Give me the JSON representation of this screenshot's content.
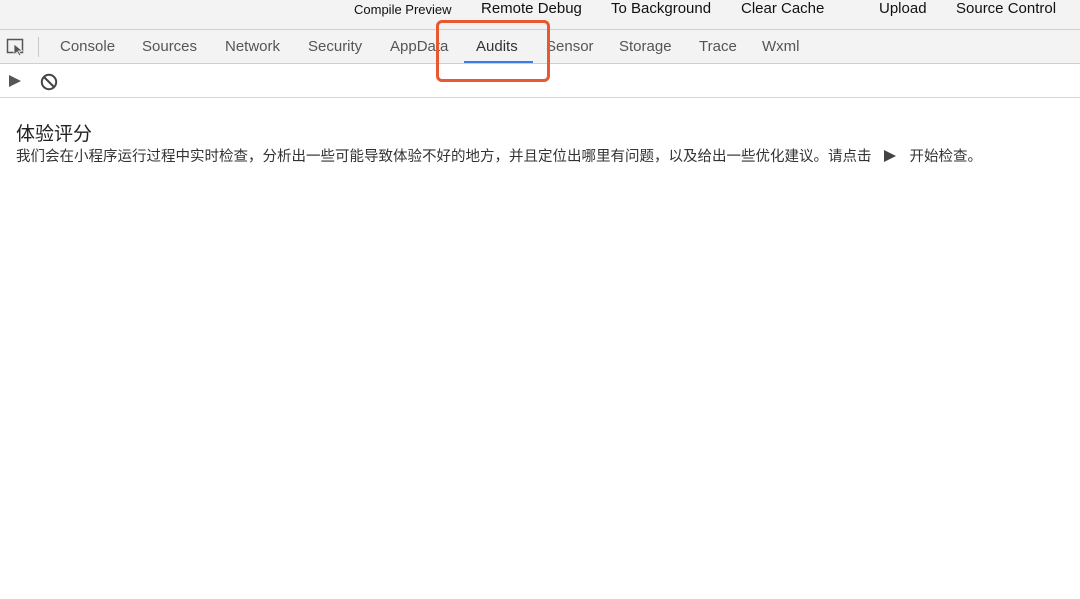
{
  "toolbar": {
    "compile_preview": "Compile Preview",
    "remote_debug": "Remote Debug",
    "to_background": "To Background",
    "clear_cache": "Clear Cache",
    "upload": "Upload",
    "source_control": "Source Control"
  },
  "tabs": {
    "console": "Console",
    "sources": "Sources",
    "network": "Network",
    "security": "Security",
    "appdata": "AppData",
    "audits": "Audits",
    "sensor": "Sensor",
    "storage": "Storage",
    "trace": "Trace",
    "wxml": "Wxml",
    "active": "Audits"
  },
  "audits": {
    "title": "体验评分",
    "description_before": "我们会在小程序运行过程中实时检查，分析出一些可能导致体验不好的地方，并且定位出哪里有问题，以及给出一些优化建议。请点击",
    "description_after": "开始检查。"
  },
  "icons": {
    "inspect": "inspect-element-icon",
    "play": "play-icon",
    "clear": "block-icon",
    "inline_play": "play-icon"
  },
  "colors": {
    "active_tab_underline": "#3b7ce9",
    "highlight_border": "#e8592f",
    "tabbar_bg": "#f3f3f3"
  }
}
